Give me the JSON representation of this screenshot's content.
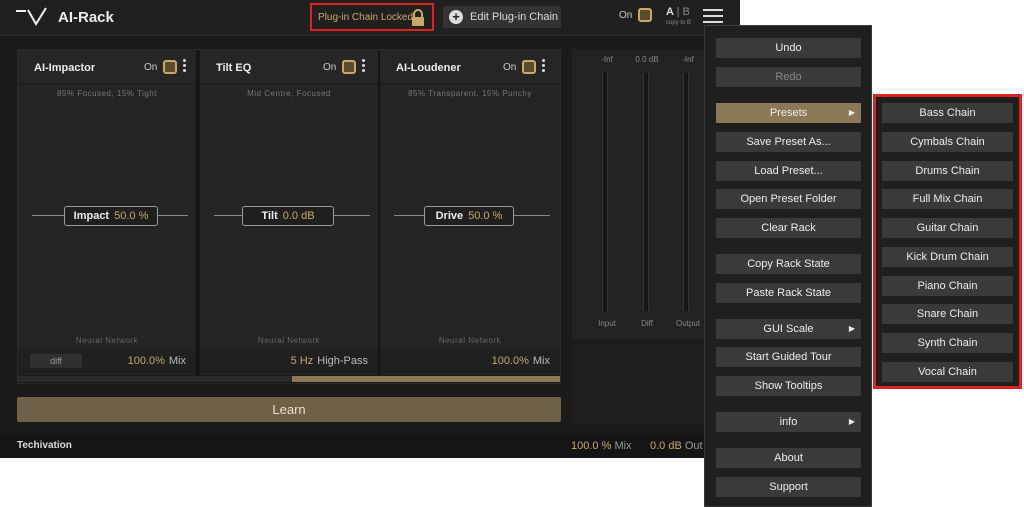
{
  "header": {
    "title": "AI-Rack",
    "lock_label": "Plug-in Chain Locked",
    "edit_chain_label": "Edit Plug-in Chain",
    "on_label": "On",
    "ab_a": "A",
    "ab_sep": "|",
    "ab_b": "B",
    "copy_to_b": "copy to B"
  },
  "modules": [
    {
      "name": "AI-Impactor",
      "on_label": "On",
      "subtitle": "85% Focused, 15% Tight",
      "param_name": "Impact",
      "param_value": "50.0 %",
      "footer": "Neural Network",
      "chip": "diff",
      "bottom_value": "100.0%",
      "bottom_unit": "Mix"
    },
    {
      "name": "Tilt EQ",
      "on_label": "On",
      "subtitle": "Mid Centre, Focused",
      "param_name": "Tilt",
      "param_value": "0.0 dB",
      "footer": "Neural Network",
      "bottom_value": "5 Hz",
      "bottom_unit": "High-Pass"
    },
    {
      "name": "AI-Loudener",
      "on_label": "On",
      "subtitle": "85% Transparent, 15% Punchy",
      "param_name": "Drive",
      "param_value": "50.0 %",
      "footer": "Neural Network",
      "bottom_value": "100.0%",
      "bottom_unit": "Mix"
    }
  ],
  "scroll_position": 0.5,
  "learn_label": "Learn",
  "meters": {
    "top_labels": [
      "-Inf",
      "0.0 dB",
      "-Inf"
    ],
    "bottom_labels": [
      "Input",
      "Diff",
      "Output"
    ]
  },
  "footer": {
    "brand": "Techivation",
    "mix_value": "100.0 %",
    "mix_label": "Mix",
    "out_value": "0.0 dB",
    "out_label": "Out"
  },
  "main_menu": [
    {
      "label": "Undo"
    },
    {
      "label": "Redo",
      "disabled": true
    },
    {
      "label": "Presets",
      "submenu": true,
      "active": true
    },
    {
      "label": "Save Preset As..."
    },
    {
      "label": "Load Preset..."
    },
    {
      "label": "Open Preset Folder"
    },
    {
      "label": "Clear Rack"
    },
    {
      "label": "Copy Rack State"
    },
    {
      "label": "Paste Rack State"
    },
    {
      "label": "GUI Scale",
      "submenu": true
    },
    {
      "label": "Start Guided Tour"
    },
    {
      "label": "Show Tooltips"
    },
    {
      "label": "info",
      "submenu": true
    },
    {
      "label": "About"
    },
    {
      "label": "Support"
    }
  ],
  "presets_menu": [
    "Bass Chain",
    "Cymbals Chain",
    "Drums Chain",
    "Full Mix Chain",
    "Guitar Chain",
    "Kick Drum Chain",
    "Piano Chain",
    "Snare Chain",
    "Synth Chain",
    "Vocal Chain"
  ],
  "icons": {
    "logo": "techivation-logo",
    "lock": "lock-icon",
    "plus": "plus-circle-icon",
    "menu": "hamburger-menu-icon",
    "more": "vertical-dots-icon",
    "submenu": "triangle-right-icon"
  },
  "colors": {
    "accent_gold": "#c9a86a",
    "highlight_red": "#dd2222",
    "active_item": "#8a7856",
    "background": "#1b1b1b"
  }
}
